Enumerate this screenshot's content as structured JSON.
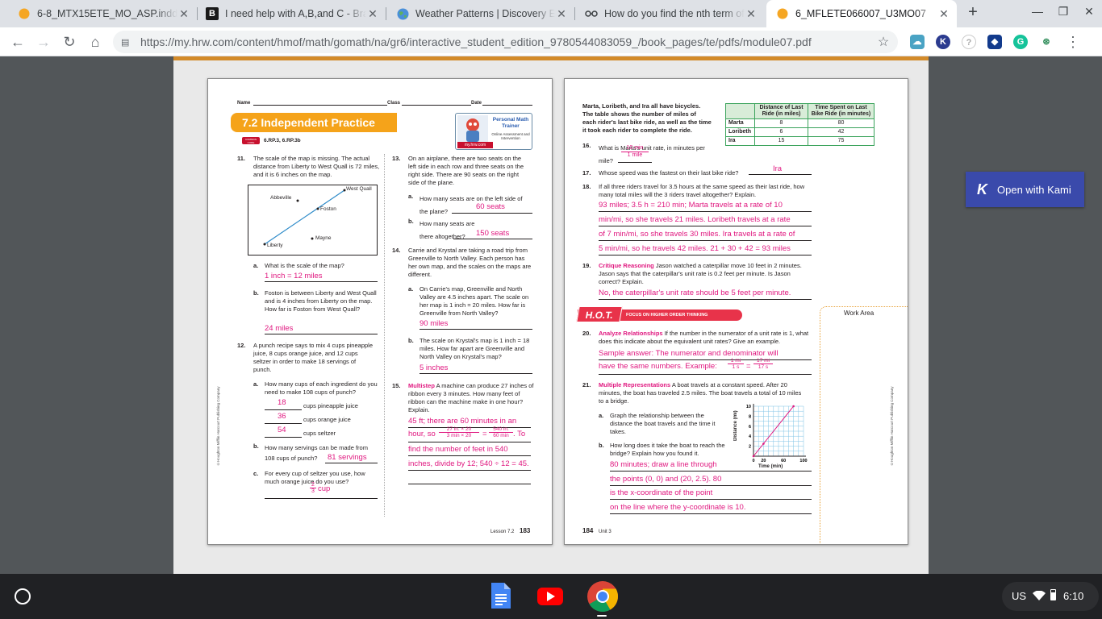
{
  "tabs": [
    {
      "title": "6-8_MTX15ETE_MO_ASP.indd",
      "icon": "orange-dot-icon"
    },
    {
      "title": "I need help with A,B,and C - Brainly",
      "icon": "brainly-icon"
    },
    {
      "title": "Weather Patterns | Discovery Education",
      "icon": "globe-icon"
    },
    {
      "title": "How do you find the nth term of",
      "icon": "glasses-icon"
    },
    {
      "title": "6_MFLETE066007_U3MO07",
      "icon": "orange-dot-icon"
    }
  ],
  "address": {
    "url": "https://my.hrw.com/content/hmof/math/gomath/na/gr6/interactive_student_edition_9780544083059_/book_pages/te/pdfs/module07.pdf"
  },
  "kami_label": "Open with Kami",
  "tray": {
    "locale": "US",
    "time": "6:10"
  },
  "page183": {
    "name_label": "Name",
    "class_label": "Class",
    "date_label": "Date",
    "heading": "7.2 Independent Practice",
    "core_badge": "COMMON CORE",
    "standards": "6.RP.3, 6.RP.3b",
    "trainer_title": "Personal Math Trainer",
    "trainer_sub": "Online Assessment and Intervention",
    "trainer_site": "my.hrw.com",
    "copyright": "©Houghton Mifflin Harcourt Publishing Company",
    "footer": "Lesson 7.2",
    "page_no": "183",
    "q11": {
      "num": "11.",
      "text": "The scale of the map is missing. The actual distance from Liberty to West Quall is 72 miles, and it is 6 inches on the map.",
      "map": {
        "west_quall": "West Quall",
        "abbeville": "Abbeville",
        "foston": "Foston",
        "mayne": "Mayne",
        "liberty": "Liberty"
      },
      "a_label": "a.",
      "a_text": "What is the scale of the map?",
      "a_ans": "1 inch = 12 miles",
      "b_label": "b.",
      "b_text": "Foston is between Liberty and West Quall and is 4 inches from Liberty on the map. How far is Foston from West Quall?",
      "b_ans": "24 miles"
    },
    "q12": {
      "num": "12.",
      "text": "A punch recipe says to mix 4 cups pineapple juice, 8 cups orange juice, and 12 cups seltzer in order to make 18 servings of punch.",
      "a_label": "a.",
      "a_text": "How many cups of each ingredient do you need to make 108 cups of punch?",
      "a_ans1": "18",
      "a_lbl1": "cups pineapple juice",
      "a_ans2": "36",
      "a_lbl2": "cups orange juice",
      "a_ans3": "54",
      "a_lbl3": "cups seltzer",
      "b_label": "b.",
      "b_text": "How many servings can be made from 108 cups of punch?",
      "b_ans": "81 servings",
      "c_label": "c.",
      "c_text": "For every cup of seltzer you use, how much orange juice do you use?",
      "c_num": "2",
      "c_den": "3",
      "c_unit": "cup"
    },
    "q13": {
      "num": "13.",
      "text": "On an airplane, there are two seats on the left side in each row and three seats on the right side. There are 90 seats on the right side of the plane.",
      "a_label": "a.",
      "a_text": "How many seats are on the left side of the plane?",
      "a_ans": "60 seats",
      "b_label": "b.",
      "b_text": "How many seats are there altogether?",
      "b_ans": "150 seats"
    },
    "q14": {
      "num": "14.",
      "text": "Carrie and Krystal are taking a road trip from Greenville to North Valley. Each person has her own map, and the scales on the maps are different.",
      "a_label": "a.",
      "a_text": "On Carrie's map, Greenville and North Valley are 4.5 inches apart. The scale on her map is 1 inch = 20 miles. How far is Greenville from North Valley?",
      "a_ans": "90 miles",
      "b_label": "b.",
      "b_text": "The scale on Krystal's map is 1 inch = 18 miles. How far apart are Greenville and North Valley on Krystal's map?",
      "b_ans": "5 inches"
    },
    "q15": {
      "num": "15.",
      "tag": "Multistep",
      "text": "A machine can produce 27 inches of ribbon every 3 minutes. How many feet of ribbon can the machine make in one hour? Explain.",
      "ans1": "45 ft; there are 60 minutes in an",
      "ans2a": "hour, so",
      "f1n": "27 in. × 20",
      "f1d": "3 min × 20",
      "eq": "=",
      "f2n": "540 in.",
      "f2d": "60 min",
      "ans2b": ". To",
      "ans3": "find the number of feet in 540",
      "ans4": "inches, divide by 12; 540 ÷ 12 = 45."
    }
  },
  "page184": {
    "intro": "Marta, Loribeth, and Ira all have bicycles. The table shows the number of miles of each rider's last bike ride, as well as the time it took each rider to complete the ride.",
    "table": {
      "headers": [
        "",
        "Distance of Last Ride (in miles)",
        "Time Spent on Last Bike Ride (in minutes)"
      ],
      "rows": [
        [
          "Marta",
          "8",
          "80"
        ],
        [
          "Loribeth",
          "6",
          "42"
        ],
        [
          "Ira",
          "15",
          "75"
        ]
      ]
    },
    "q16": {
      "num": "16.",
      "text": "What is Marta's unit rate, in minutes per mile?",
      "num_ans": "10 min",
      "den_ans": "1 mile"
    },
    "q17": {
      "num": "17.",
      "text": "Whose speed was the fastest on their last bike ride?",
      "ans": "Ira"
    },
    "q18": {
      "num": "18.",
      "text": "If all three riders travel for 3.5 hours at the same speed as their last ride, how many total miles will the 3 riders travel altogether? Explain.",
      "ans": [
        "93 miles; 3.5 h = 210 min; Marta travels at a rate of 10",
        "min/mi, so she travels 21 miles. Loribeth travels at a rate",
        "of 7 min/mi, so she travels 30 miles. Ira travels at a rate of",
        "5 min/mi, so he travels 42 miles. 21 + 30 + 42 = 93 miles"
      ]
    },
    "q19": {
      "num": "19.",
      "tag": "Critique Reasoning",
      "text": "Jason watched a caterpillar move 10 feet in 2 minutes. Jason says that the caterpillar's unit rate is 0.2 feet per minute. Is Jason correct? Explain.",
      "ans": "No, the caterpillar's unit rate should be 5 feet per minute."
    },
    "hot_logo": "H.O.T.",
    "hot_banner": "FOCUS ON HIGHER ORDER THINKING",
    "work_area": "Work Area",
    "q20": {
      "num": "20.",
      "tag": "Analyze Relationships",
      "text": "If the number in the numerator of a unit rate is 1, what does this indicate about the equivalent unit rates? Give an example.",
      "ans1": "Sample answer: The numerator and denominator will",
      "ans2": "have the same numbers. Example:",
      "f1n": "1 mi",
      "f1d": "1 s",
      "eq": "=",
      "f2n": "17 mi",
      "f2d": "17 s"
    },
    "q21": {
      "num": "21.",
      "tag": "Multiple Representations",
      "text": "A boat travels at a constant speed. After 20 minutes, the boat has traveled 2.5 miles. The boat travels a total of 10 miles to a bridge.",
      "a_label": "a.",
      "a_text": "Graph the relationship between the distance the boat travels and the time it takes.",
      "b_label": "b.",
      "b_text": "How long does it take the boat to reach the bridge? Explain how you found it.",
      "b_ans": [
        "80 minutes; draw a line through",
        "the points (0, 0) and (20, 2.5). 80",
        "is the x-coordinate of the point",
        "on the line where the y-coordinate is 10."
      ]
    },
    "copyright": "©Houghton Mifflin Harcourt Publishing Company",
    "page_no": "184",
    "footer": "Unit 3"
  },
  "chart_data": {
    "type": "line",
    "xlabel": "Time (min)",
    "ylabel": "Distance (mi)",
    "xlim": [
      0,
      100
    ],
    "ylim": [
      0,
      10
    ],
    "x_ticks": [
      "0",
      "20",
      "60",
      "100"
    ],
    "y_ticks": [
      "2",
      "4",
      "6",
      "8",
      "10"
    ],
    "grid": true,
    "series": [
      {
        "x": [
          0,
          20,
          80
        ],
        "y": [
          0,
          2.5,
          10
        ]
      }
    ]
  }
}
